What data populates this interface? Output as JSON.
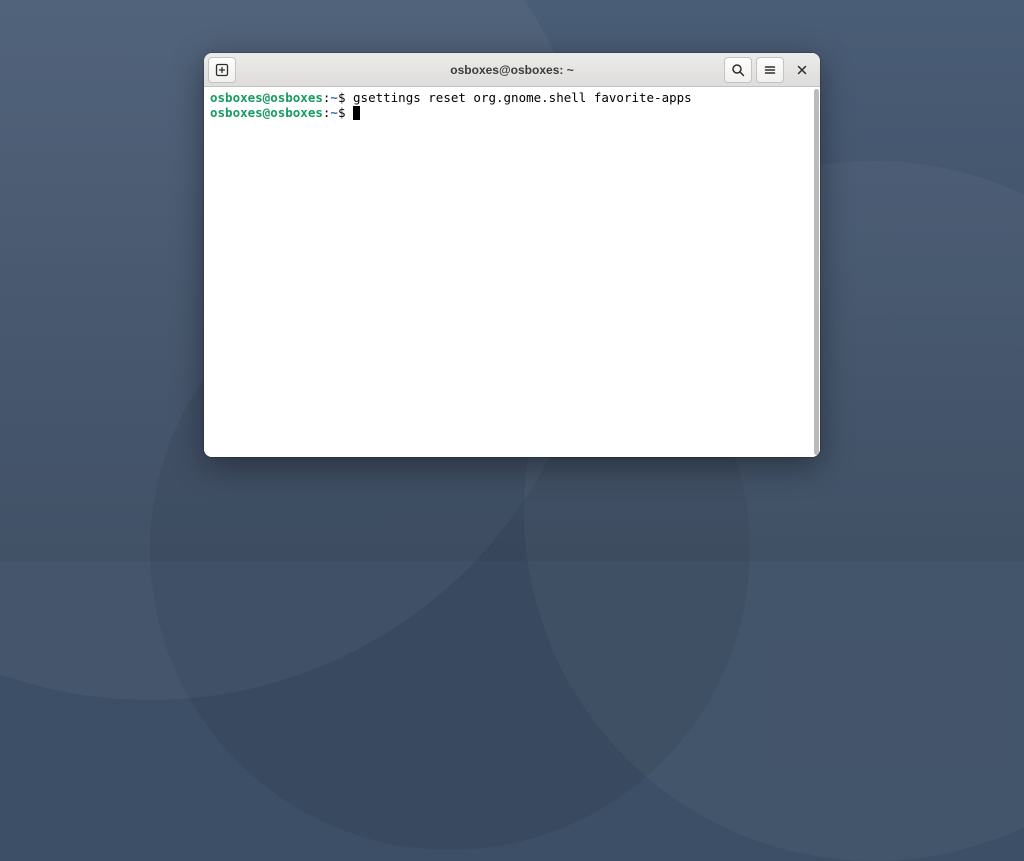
{
  "window": {
    "title": "osboxes@osboxes: ~"
  },
  "terminal": {
    "lines": [
      {
        "prompt": "osboxes@osboxes",
        "sep": ":",
        "path": "~",
        "dollar": "$ ",
        "cmd": "gsettings reset org.gnome.shell favorite-apps"
      },
      {
        "prompt": "osboxes@osboxes",
        "sep": ":",
        "path": "~",
        "dollar": "$ ",
        "cmd": ""
      }
    ]
  }
}
